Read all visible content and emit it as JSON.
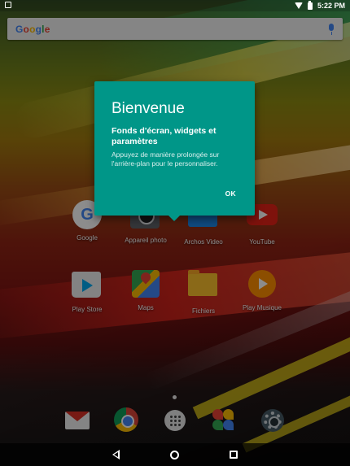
{
  "status_bar": {
    "time": "5:22 PM",
    "icons": [
      "notification-icon",
      "wifi-icon",
      "battery-icon"
    ]
  },
  "search_bar": {
    "logo_letters": [
      "G",
      "o",
      "o",
      "g",
      "l",
      "e"
    ],
    "icons": [
      "mic-icon"
    ]
  },
  "welcome_card": {
    "title": "Bienvenue",
    "subtitle": "Fonds d'écran, widgets et paramètres",
    "body": "Appuyez de manière prolongée sur l'arrière-plan pour le personnaliser.",
    "ok_label": "OK",
    "background_color": "#009688"
  },
  "apps": [
    {
      "label": "Google",
      "icon": "google-icon"
    },
    {
      "label": "Appareil photo",
      "icon": "camera-icon"
    },
    {
      "label": "Archos Video",
      "icon": "archos-video-icon"
    },
    {
      "label": "YouTube",
      "icon": "youtube-icon"
    },
    {
      "label": "Play Store",
      "icon": "play-store-icon"
    },
    {
      "label": "Maps",
      "icon": "maps-icon"
    },
    {
      "label": "Fichiers",
      "icon": "files-icon"
    },
    {
      "label": "Play Musique",
      "icon": "play-music-icon"
    }
  ],
  "dock": [
    "gmail-icon",
    "chrome-icon",
    "app-drawer-icon",
    "photos-icon",
    "settings-icon"
  ],
  "nav_bar": [
    "back-icon",
    "home-icon",
    "recents-icon"
  ]
}
